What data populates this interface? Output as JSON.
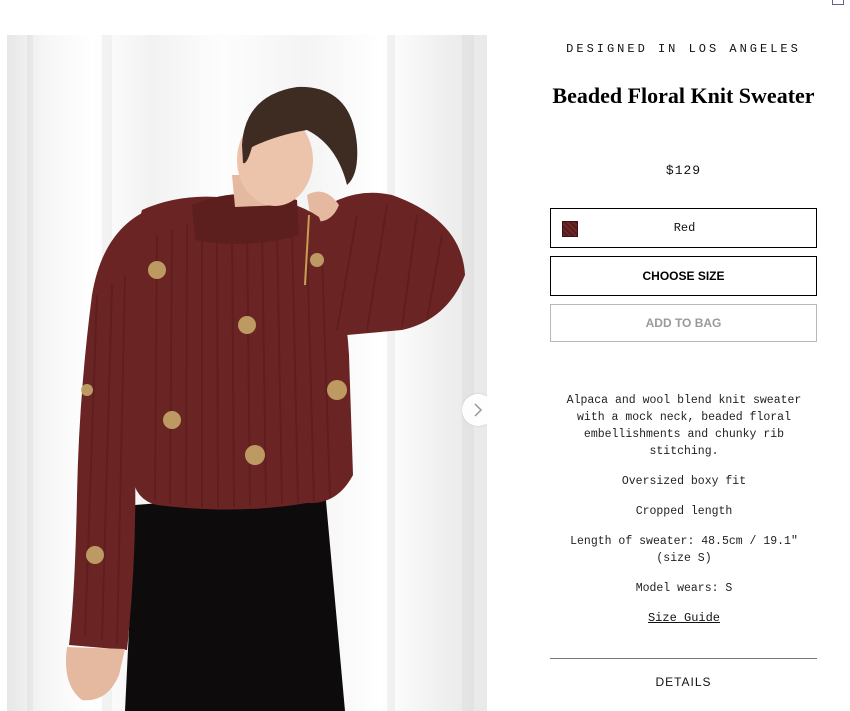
{
  "product": {
    "eyebrow": "DESIGNED IN LOS ANGELES",
    "title": "Beaded Floral Knit Sweater",
    "price": "$129"
  },
  "color_select": {
    "label": "Red",
    "swatch_color": "#6e2626"
  },
  "actions": {
    "choose_size": "CHOOSE SIZE",
    "add_to_bag": "ADD TO BAG"
  },
  "description": {
    "summary": "Alpaca and wool blend knit sweater with a mock neck, beaded floral embellishments and chunky rib stitching.",
    "fit": "Oversized boxy fit",
    "length": "Cropped length",
    "measurement": "Length of sweater: 48.5cm / 19.1\" (size S)",
    "model": "Model wears: S",
    "size_guide": "Size Guide"
  },
  "details": {
    "heading": "DETAILS"
  },
  "gallery": {
    "next_icon": "chevron-right-icon",
    "sweater_color": "#6b2424"
  }
}
